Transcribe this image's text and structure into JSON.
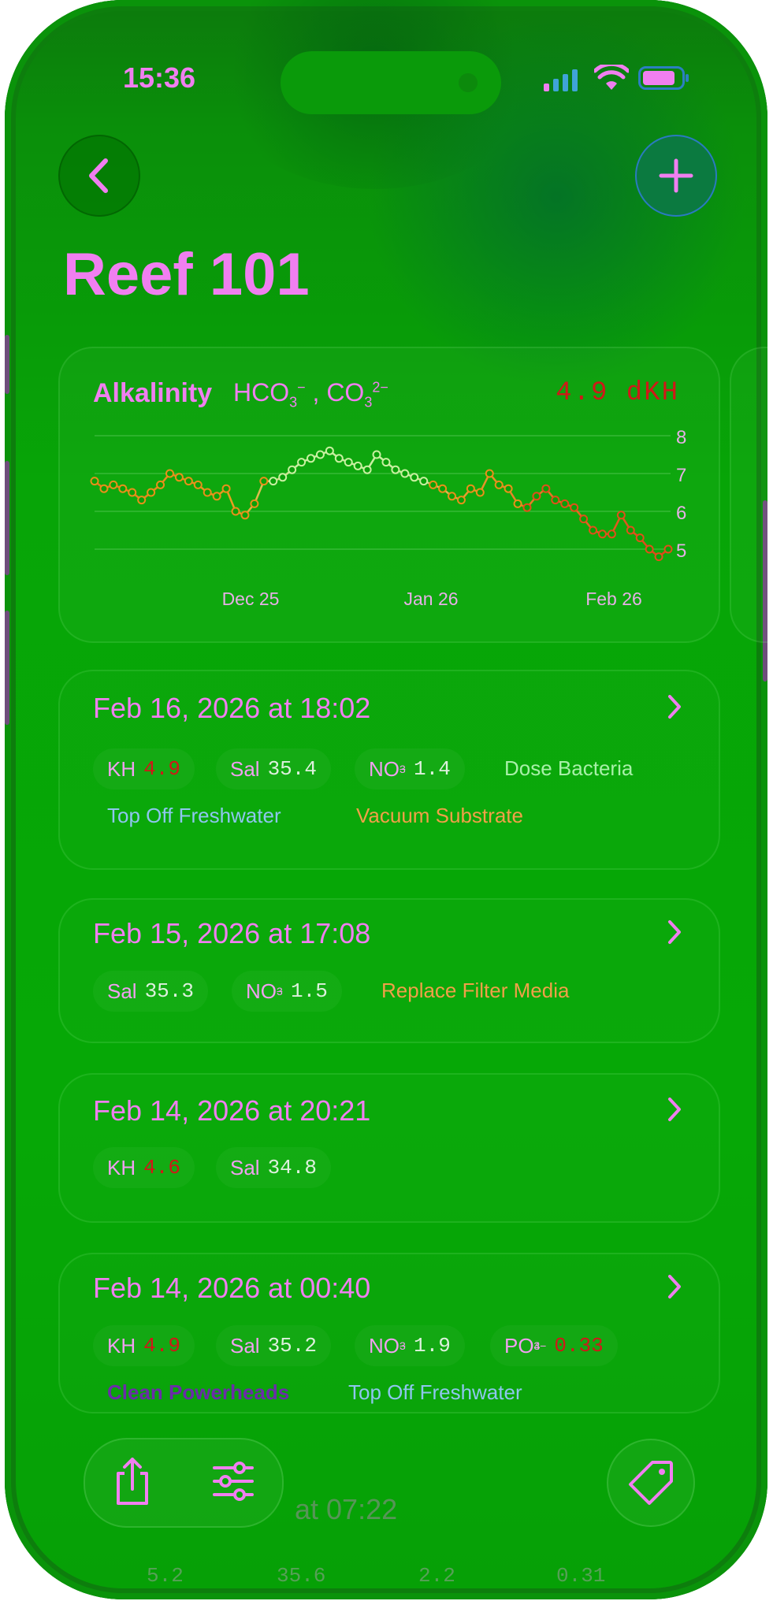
{
  "status_bar": {
    "time": "15:36"
  },
  "nav": {
    "title": "Reef 101"
  },
  "chart": {
    "label": "Alkalinity",
    "formula_a": "HCO",
    "formula_a_sub": "3",
    "formula_a_sup": "−",
    "formula_sep": " , ",
    "formula_b": "CO",
    "formula_b_sub": "3",
    "formula_b_sup": "2−",
    "current_value": "4.9 dKH",
    "y_ticks": [
      "8",
      "7",
      "6",
      "5"
    ],
    "x_ticks": [
      "Dec 25",
      "Jan 26",
      "Feb 26"
    ]
  },
  "chart_data": {
    "type": "line",
    "title": "",
    "ylabel": "",
    "x_tick_labels": [
      "Dec 25",
      "Jan 26",
      "Feb 26"
    ],
    "ylim": [
      4.5,
      8.2
    ],
    "grid": true,
    "series": [
      {
        "values": [
          6.8,
          6.6,
          6.7,
          6.6,
          6.5,
          6.3,
          6.5,
          6.7,
          7.0,
          6.9,
          6.8,
          6.7,
          6.5,
          6.4,
          6.6,
          6.0,
          5.9,
          6.2,
          6.8,
          6.8,
          6.9,
          7.1,
          7.3,
          7.4,
          7.5,
          7.6,
          7.4,
          7.3,
          7.2,
          7.1,
          7.5,
          7.3,
          7.1,
          7.0,
          6.9,
          6.8,
          6.7,
          6.6,
          6.4,
          6.3,
          6.6,
          6.5,
          7.0,
          6.7,
          6.6,
          6.2,
          6.1,
          6.4,
          6.6,
          6.3,
          6.2,
          6.1,
          5.8,
          5.5,
          5.4,
          5.4,
          5.9,
          5.5,
          5.3,
          5.0,
          4.8,
          5.0
        ]
      }
    ]
  },
  "entries": [
    {
      "date": "Feb 16, 2026 at 18:02",
      "params": [
        {
          "label": "KH",
          "value": "4.9"
        },
        {
          "label": "Sal",
          "value": "35.4"
        },
        {
          "label": "NO",
          "value": "1.4"
        }
      ],
      "tags": [
        "Dose Bacteria",
        "Top Off Freshwater",
        "Vacuum Substrate"
      ]
    },
    {
      "date": "Feb 15, 2026 at 17:08",
      "params": [
        {
          "label": "Sal",
          "value": "35.3"
        },
        {
          "label": "NO",
          "value": "1.5"
        }
      ],
      "tags": [
        "Replace Filter Media"
      ]
    },
    {
      "date": "Feb 14, 2026 at 20:21",
      "params": [
        {
          "label": "KH",
          "value": "4.6"
        },
        {
          "label": "Sal",
          "value": "34.8"
        }
      ],
      "tags": []
    },
    {
      "date": "Feb 14, 2026 at 00:40",
      "params": [
        {
          "label": "KH",
          "value": "4.9"
        },
        {
          "label": "Sal",
          "value": "35.2"
        },
        {
          "label": "NO",
          "value": "1.9"
        },
        {
          "label": "PO",
          "value": "0.33"
        }
      ],
      "tags": [
        "Clean Powerheads",
        "Top Off Freshwater"
      ]
    }
  ],
  "formula_no3": {
    "sub": "3",
    "sup": "−"
  },
  "formula_po4": {
    "sub": "4",
    "sup": "3−"
  },
  "partial_entry": {
    "date": "at 07:22"
  },
  "partial_row_values": [
    "5.2",
    "35.6",
    "2.2",
    "0.31"
  ],
  "colors": {
    "accent": "#f07ff0",
    "alert_red": "#d01818",
    "tag_green": "#a8f0a8",
    "tag_blue": "#8ec6ee",
    "tag_orange": "#f0a048",
    "tag_purple": "#6a2ca8"
  }
}
